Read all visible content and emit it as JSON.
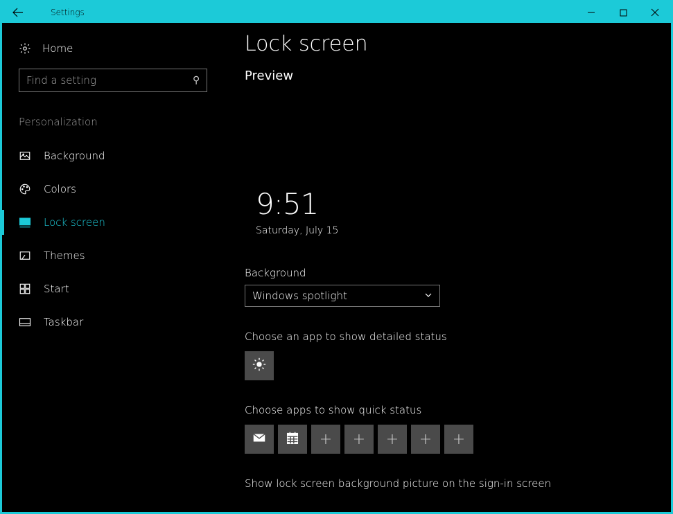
{
  "titlebar": {
    "title": "Settings"
  },
  "sidebar": {
    "home_label": "Home",
    "search_placeholder": "Find a setting",
    "category": "Personalization",
    "items": [
      {
        "label": "Background",
        "icon": "image-icon"
      },
      {
        "label": "Colors",
        "icon": "palette-icon"
      },
      {
        "label": "Lock screen",
        "icon": "monitor-icon"
      },
      {
        "label": "Themes",
        "icon": "paint-icon"
      },
      {
        "label": "Start",
        "icon": "start-icon"
      },
      {
        "label": "Taskbar",
        "icon": "taskbar-icon"
      }
    ]
  },
  "page": {
    "title": "Lock screen",
    "preview_heading": "Preview",
    "preview_time": "9:51",
    "preview_date": "Saturday, July 15",
    "background_label": "Background",
    "background_value": "Windows spotlight",
    "detailed_label": "Choose an app to show detailed status",
    "quick_label": "Choose apps to show quick status",
    "signin_label": "Show lock screen background picture on the sign-in screen"
  }
}
